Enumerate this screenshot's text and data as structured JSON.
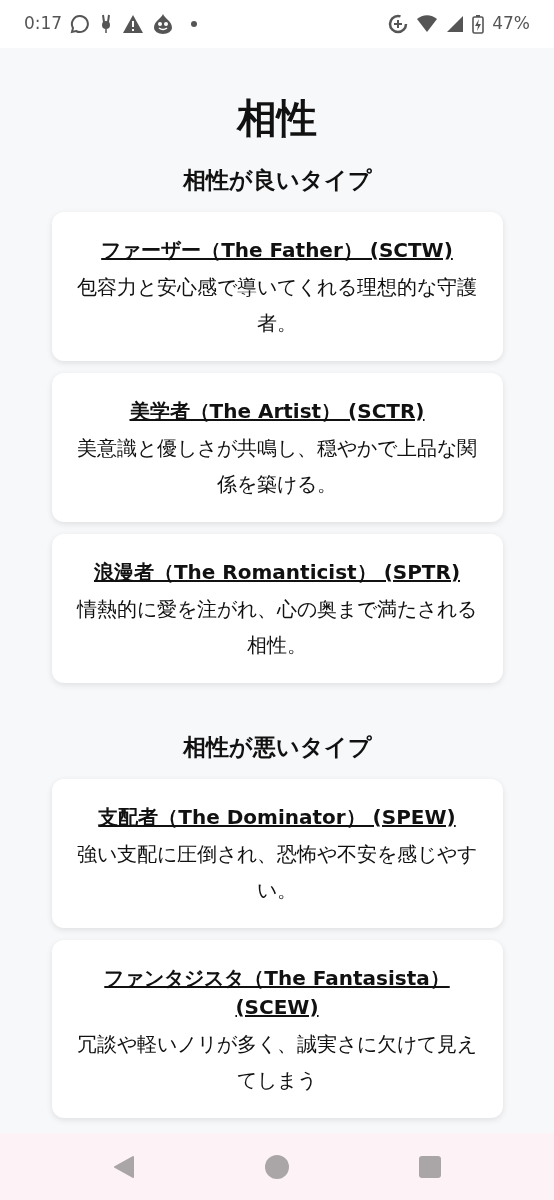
{
  "status_bar": {
    "time": "0:17",
    "battery": "47%"
  },
  "title": "相性",
  "sections": [
    {
      "heading": "相性が良いタイプ",
      "cards": [
        {
          "name": "ファーザー（The Father） (SCTW)",
          "description": "包容力と安心感で導いてくれる理想的な守護者。"
        },
        {
          "name": "美学者（The Artist） (SCTR)",
          "description": "美意識と優しさが共鳴し、穏やかで上品な関係を築ける。"
        },
        {
          "name": "浪漫者（The Romanticist） (SPTR)",
          "description": "情熱的に愛を注がれ、心の奥まで満たされる相性。"
        }
      ]
    },
    {
      "heading": "相性が悪いタイプ",
      "cards": [
        {
          "name": "支配者（The Dominator） (SPEW)",
          "description": "強い支配に圧倒され、恐怖や不安を感じやすい。"
        },
        {
          "name": "ファンタジスタ（The Fantasista） (SCEW)",
          "description": "冗談や軽いノリが多く、誠実さに欠けて見えてしまう"
        }
      ]
    }
  ]
}
